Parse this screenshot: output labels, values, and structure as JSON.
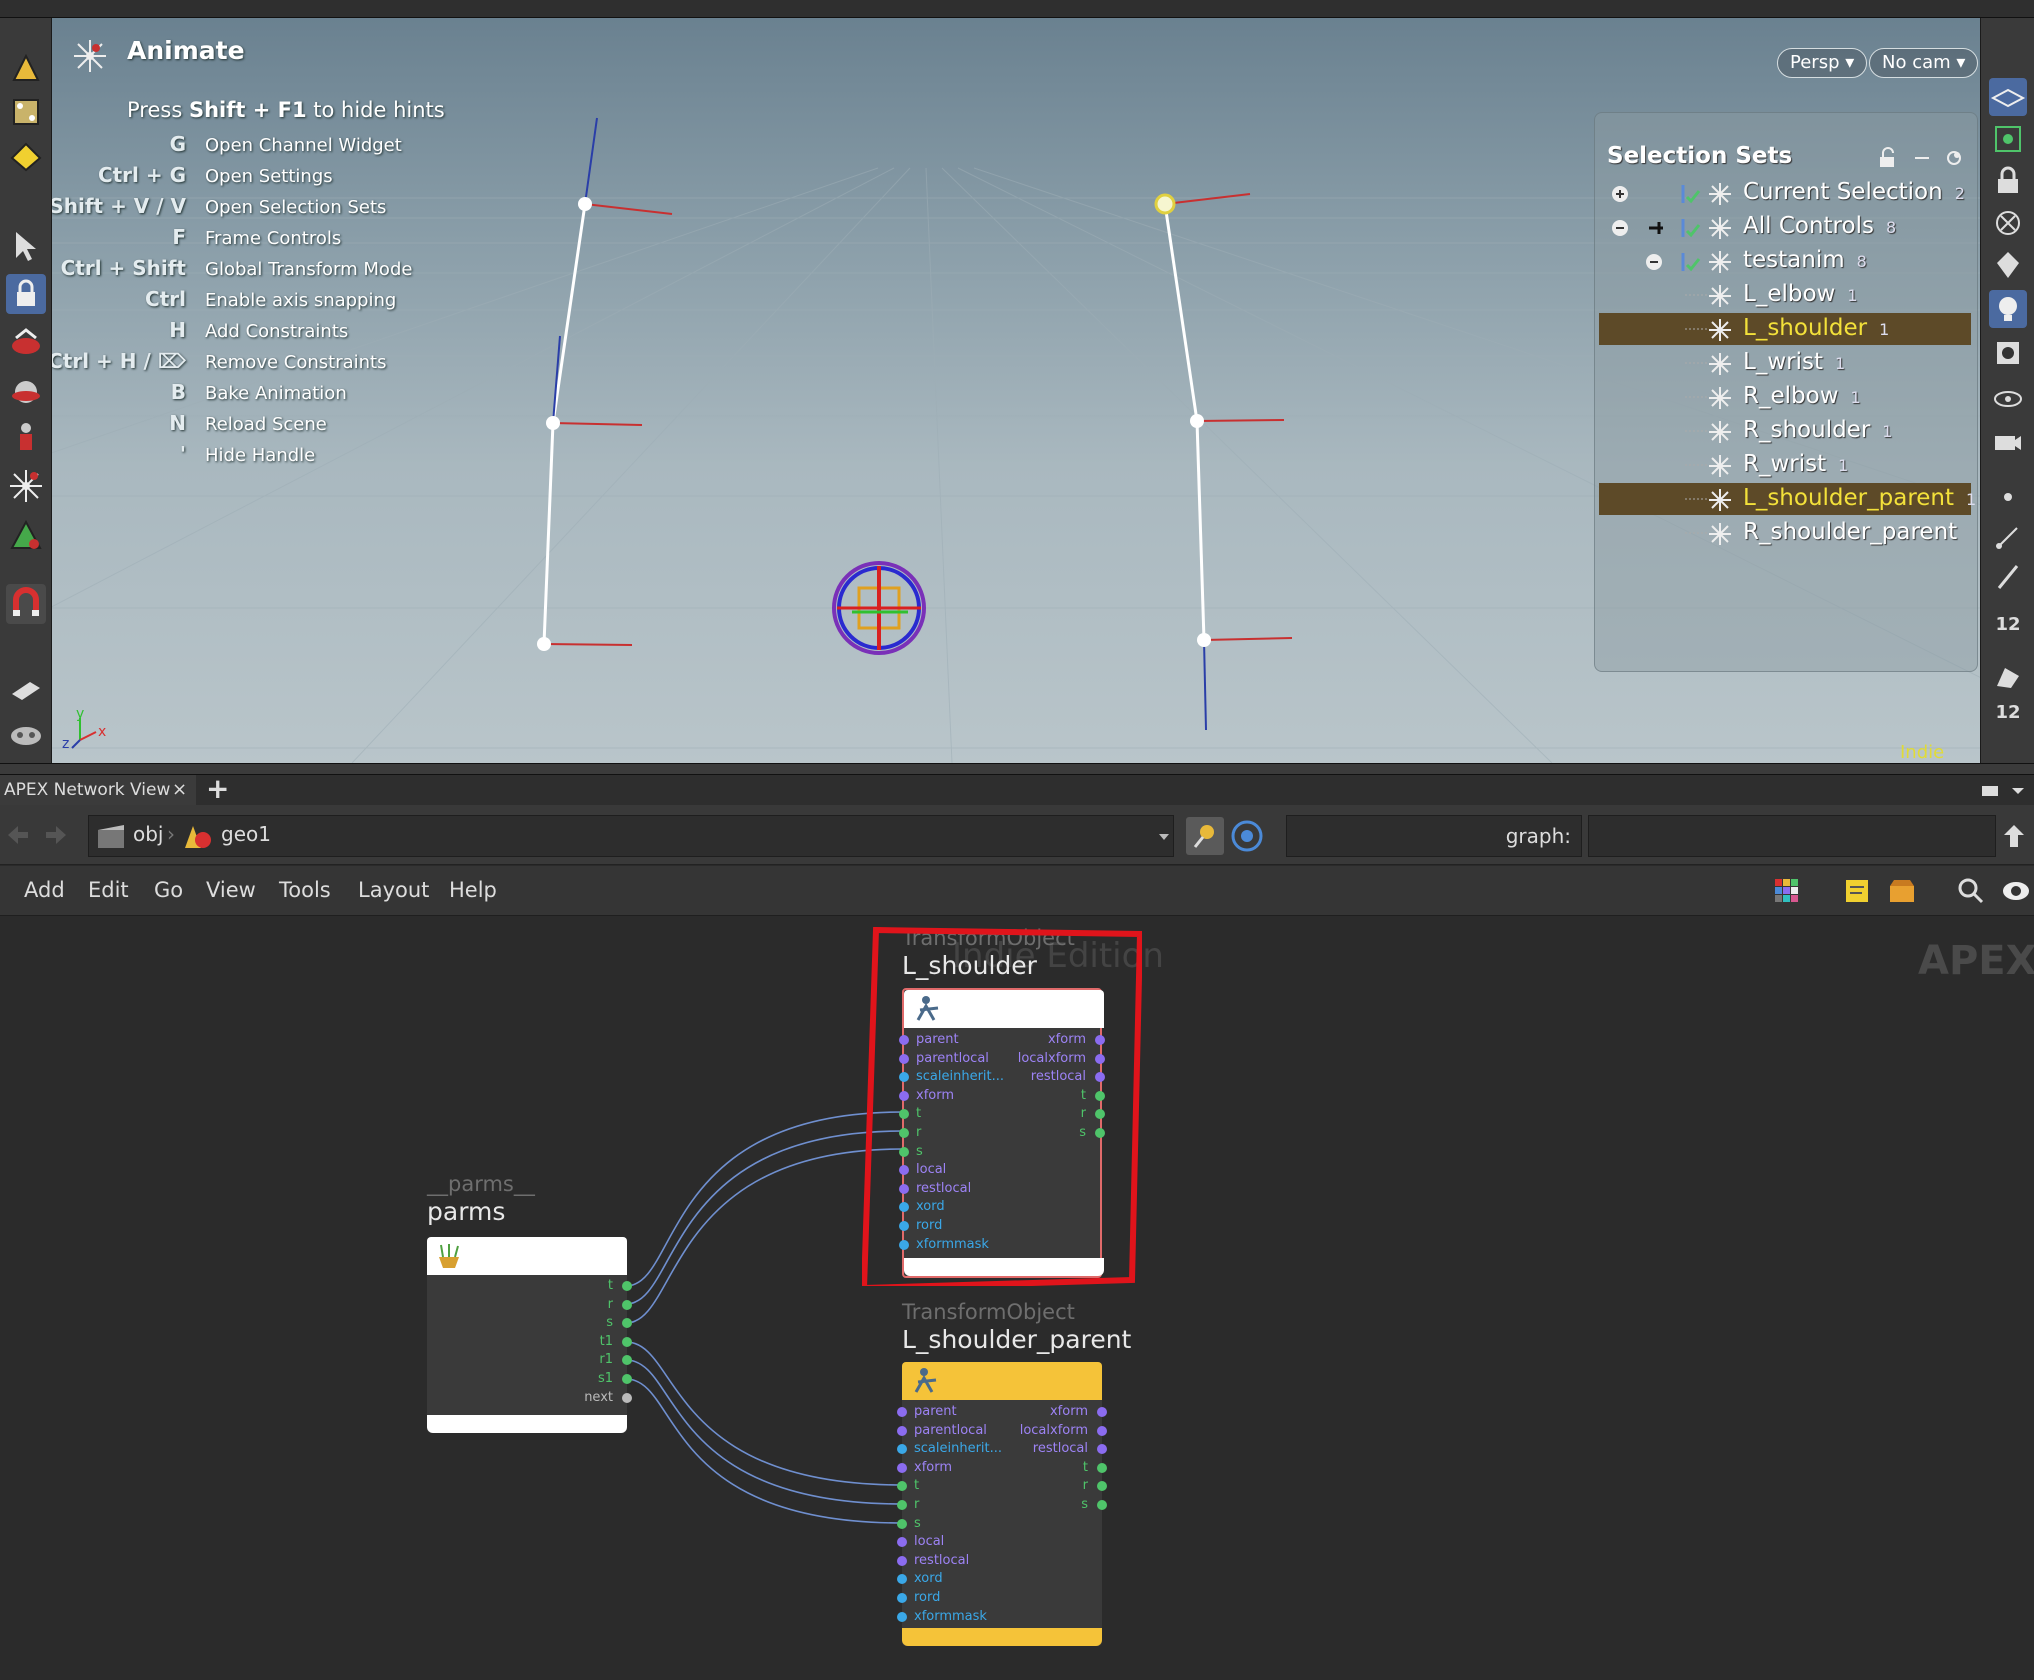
{
  "viewport": {
    "hints": {
      "title": "Animate",
      "subtitle_prefix": "Press ",
      "subtitle_key": "Shift + F1",
      "subtitle_suffix": " to hide hints",
      "rows": [
        {
          "key": "G",
          "desc": "Open Channel Widget"
        },
        {
          "key": "Ctrl + G",
          "desc": "Open Settings"
        },
        {
          "key": "Shift + V / V",
          "desc": "Open Selection Sets"
        },
        {
          "key": "F",
          "desc": "Frame Controls"
        },
        {
          "key": "Ctrl + Shift",
          "desc": "Global Transform Mode"
        },
        {
          "key": "Ctrl",
          "desc": "Enable axis snapping"
        },
        {
          "key": "H",
          "desc": "Add Constraints"
        },
        {
          "key": "Ctrl + H / ⌦",
          "desc": "Remove Constraints"
        },
        {
          "key": "B",
          "desc": "Bake Animation"
        },
        {
          "key": "N",
          "desc": "Reload Scene"
        },
        {
          "key": "'",
          "desc": "Hide Handle"
        }
      ]
    },
    "persp_button": "Persp ▾",
    "cam_button": "No cam ▾",
    "watermark": "Indie Edition",
    "axis_labels": {
      "y": "y",
      "z": "z",
      "x": "x"
    }
  },
  "selection_sets": {
    "title": "Selection Sets",
    "items": [
      {
        "label": "Current Selection",
        "count": "2",
        "selected": false
      },
      {
        "label": "All Controls",
        "count": "8",
        "selected": false
      },
      {
        "label": "testanim",
        "count": "8",
        "selected": false
      },
      {
        "label": "L_elbow",
        "count": "1",
        "selected": false
      },
      {
        "label": "L_shoulder",
        "count": "1",
        "selected": true
      },
      {
        "label": "L_wrist",
        "count": "1",
        "selected": false
      },
      {
        "label": "R_elbow",
        "count": "1",
        "selected": false
      },
      {
        "label": "R_shoulder",
        "count": "1",
        "selected": false
      },
      {
        "label": "R_wrist",
        "count": "1",
        "selected": false
      },
      {
        "label": "L_shoulder_parent",
        "count": "1",
        "selected": true
      },
      {
        "label": "R_shoulder_parent",
        "count": "",
        "selected": false
      }
    ]
  },
  "right_toolbar": {
    "num_a": "12",
    "num_b": "12"
  },
  "pane": {
    "tab_label": "APEX Network View",
    "tab_close": "×",
    "tab_add": "+",
    "path": {
      "crumb1": "obj",
      "crumb2": "geo1"
    },
    "graph_label": "graph:"
  },
  "menu": [
    "Add",
    "Edit",
    "Go",
    "View",
    "Tools",
    "Layout",
    "Help"
  ],
  "network": {
    "watermark_apex": "APEX",
    "watermark_indie": "Indie Edition",
    "nodes": {
      "l_shoulder": {
        "type": "TransformObject",
        "name": "L_shoulder",
        "inputs": [
          "parent",
          "parentlocal",
          "scaleinherit...",
          "xform",
          "t",
          "r",
          "s",
          "local",
          "restlocal",
          "xord",
          "rord",
          "xformmask"
        ],
        "outputs": [
          "xform",
          "localxform",
          "restlocal",
          "t",
          "r",
          "s"
        ]
      },
      "l_shoulder_parent": {
        "type": "TransformObject",
        "name": "L_shoulder_parent",
        "inputs": [
          "parent",
          "parentlocal",
          "scaleinherit...",
          "xform",
          "t",
          "r",
          "s",
          "local",
          "restlocal",
          "xord",
          "rord",
          "xformmask"
        ],
        "outputs": [
          "xform",
          "localxform",
          "restlocal",
          "t",
          "r",
          "s"
        ]
      },
      "parms": {
        "type": "__parms__",
        "name": "parms",
        "outputs": [
          "t",
          "r",
          "s",
          "t1",
          "r1",
          "s1",
          "next"
        ]
      }
    },
    "colors": {
      "selected_outline": "#e0141b",
      "node_head_l_shoulder_parent": "#f5c339",
      "wire": "#6f8fcf",
      "port_purple": "#8b6cf0",
      "port_blue": "#3aa8e8",
      "port_green": "#4fc46a"
    }
  }
}
